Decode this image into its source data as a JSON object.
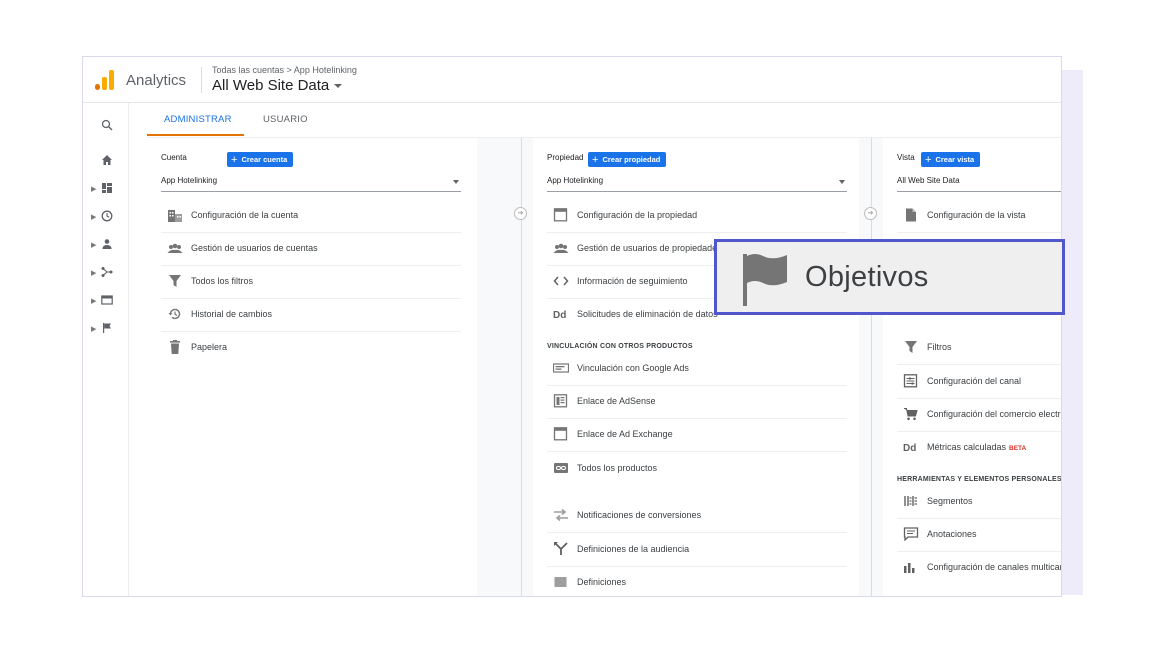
{
  "header": {
    "app_name": "Analytics",
    "breadcrumb": "Todas las cuentas > App Hotelinking",
    "view_title": "All Web Site Data"
  },
  "tabs": [
    {
      "label": "ADMINISTRAR",
      "active": true
    },
    {
      "label": "USUARIO",
      "active": false
    }
  ],
  "sidebar": {
    "items": [
      "search-icon",
      "home-icon",
      "customization-icon",
      "realtime-icon",
      "audience-icon",
      "acquisition-icon",
      "behavior-icon",
      "conversions-icon"
    ]
  },
  "columns": {
    "account": {
      "header": "Cuenta",
      "create_label": "Crear cuenta",
      "selected": "App Hotelinking",
      "items": [
        "Configuración de la cuenta",
        "Gestión de usuarios de cuentas",
        "Todos los filtros",
        "Historial de cambios",
        "Papelera"
      ]
    },
    "property": {
      "header": "Propiedad",
      "create_label": "Crear propiedad",
      "selected": "App Hotelinking",
      "items": [
        "Configuración de la propiedad",
        "Gestión de usuarios de propiedades",
        "Información de seguimiento",
        "Solicitudes de eliminación de datos"
      ],
      "section_label": "VINCULACIÓN CON OTROS PRODUCTOS",
      "product_items": [
        "Vinculación con Google Ads",
        "Enlace de AdSense",
        "Enlace de Ad Exchange",
        "Todos los productos",
        "Notificaciones de conversiones",
        "Definiciones de la audiencia",
        "Definiciones"
      ]
    },
    "view": {
      "header": "Vista",
      "create_label": "Crear vista",
      "selected": "All Web Site Data",
      "items": [
        "Configuración de la vista",
        "Filtros",
        "Configuración del canal",
        "Configuración del comercio electrónico",
        "Métricas calculadas"
      ],
      "beta_label": "BETA",
      "section_label": "HERRAMIENTAS Y ELEMENTOS PERSONALES",
      "tool_items": [
        "Segmentos",
        "Anotaciones",
        "Configuración de canales multicanal"
      ]
    }
  },
  "callout": {
    "label": "Objetivos",
    "icon": "flag-icon"
  },
  "colors": {
    "accent": "#1a73e8",
    "tab_underline": "#e37400",
    "callout_border": "#5056cc",
    "decor": "#eeebfa"
  }
}
